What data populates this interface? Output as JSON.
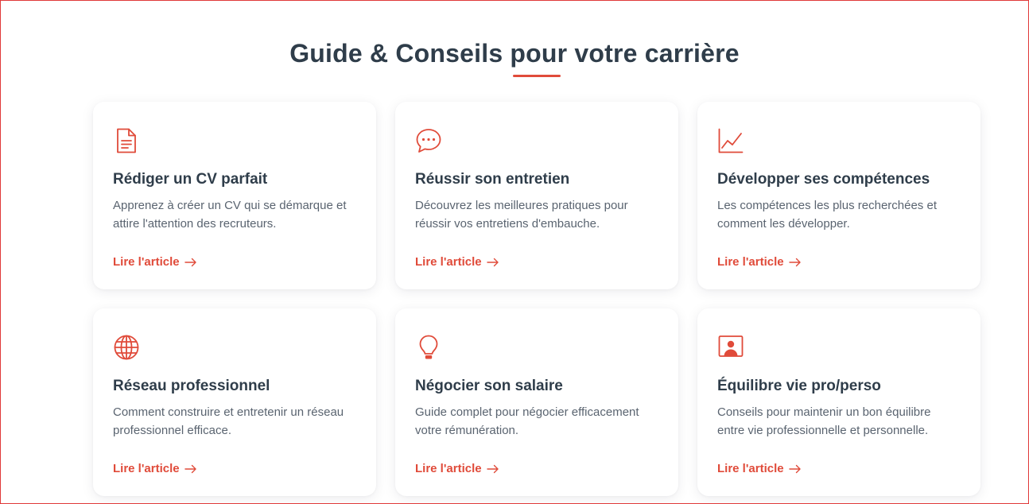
{
  "section": {
    "title": "Guide & Conseils pour votre carrière"
  },
  "colors": {
    "accent": "#e04b3a",
    "heading": "#2f3d4a",
    "body_text": "#5a6470"
  },
  "cards": [
    {
      "icon": "document-icon",
      "title": "Rédiger un CV parfait",
      "text": "Apprenez à créer un CV qui se démarque et attire l'attention des recruteurs.",
      "link": "Lire l'article"
    },
    {
      "icon": "chat-bubble-icon",
      "title": "Réussir son entretien",
      "text": "Découvrez les meilleures pratiques pour réussir vos entretiens d'embauche.",
      "link": "Lire l'article"
    },
    {
      "icon": "line-chart-icon",
      "title": "Développer ses compétences",
      "text": "Les compétences les plus recherchées et comment les développer.",
      "link": "Lire l'article"
    },
    {
      "icon": "globe-icon",
      "title": "Réseau professionnel",
      "text": "Comment construire et entretenir un réseau professionnel efficace.",
      "link": "Lire l'article"
    },
    {
      "icon": "lightbulb-icon",
      "title": "Négocier son salaire",
      "text": "Guide complet pour négocier efficacement votre rémunération.",
      "link": "Lire l'article"
    },
    {
      "icon": "person-screen-icon",
      "title": "Équilibre vie pro/perso",
      "text": "Conseils pour maintenir un bon équilibre entre vie professionnelle et personnelle.",
      "link": "Lire l'article"
    }
  ]
}
